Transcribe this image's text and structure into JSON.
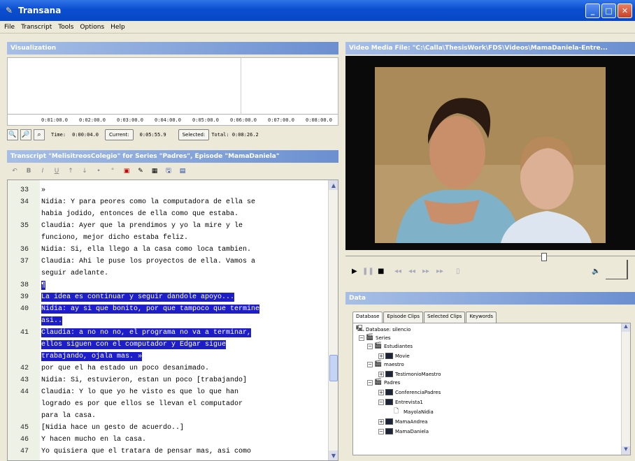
{
  "window": {
    "title": "Transana",
    "buttons": [
      "_",
      "□",
      "✕"
    ]
  },
  "menu": [
    "File",
    "Transcript",
    "Tools",
    "Options",
    "Help"
  ],
  "visualization": {
    "title": "Visualization",
    "ticks": [
      "0:01:00.0",
      "0:02:00.0",
      "0:03:00.0",
      "0:04:00.0",
      "0:05:00.0",
      "0:06:00.0",
      "0:07:00.0",
      "0:08:00.0"
    ],
    "time_label": "Time:",
    "time_value": "0:00:04.0",
    "current_label": "Current:",
    "current_value": "0:05:55.9",
    "selected_label": "Selected:",
    "total_value": "Total: 0:08:26.2"
  },
  "transcript": {
    "title": "Transcript \"MelisitreosColegio\" for Series \"Padres\", Episode \"MamaDaniela\"",
    "lines": [
      {
        "n": "33",
        "t": "»",
        "sel": false
      },
      {
        "n": "34",
        "t": "Nidia: Y para peores como la computadora de ella se",
        "sel": false
      },
      {
        "n": "",
        "t": "habia jodido, entonces de ella como que estaba.",
        "sel": false
      },
      {
        "n": "35",
        "t": "Claudia: Ayer que la prendimos y yo la mire y le",
        "sel": false
      },
      {
        "n": "",
        "t": "funciono, mejor dicho estaba feliz.",
        "sel": false
      },
      {
        "n": "36",
        "t": "Nidia: Si, ella llego a la casa como loca tambien.",
        "sel": false
      },
      {
        "n": "37",
        "t": "Claudia: Ahi le puse los proyectos de ella. Vamos a",
        "sel": false
      },
      {
        "n": "",
        "t": "seguir adelante.",
        "sel": false
      },
      {
        "n": "38",
        "t": "¶",
        "sel": true
      },
      {
        "n": "39",
        "t": "La idea es continuar y seguir dandole apoyo...",
        "sel": true
      },
      {
        "n": "40",
        "t": "Nidia: ay si que bonito, por que tampoco que termine",
        "sel": true
      },
      {
        "n": "",
        "t": "asi..",
        "sel": true
      },
      {
        "n": "41",
        "t": "Claudia: a no no no, el programa no va a terminar,",
        "sel": true
      },
      {
        "n": "",
        "t": "ellos siguen con el computador y Edgar sigue",
        "sel": true
      },
      {
        "n": "",
        "t": "trabajando, ojala mas. »",
        "sel": true
      },
      {
        "n": "42",
        "t": "por que el ha estado un poco desanimado.",
        "sel": false
      },
      {
        "n": "43",
        "t": "Nidia: Si, estuvieron, estan un poco [trabajando]",
        "sel": false
      },
      {
        "n": "44",
        "t": "Claudia: Y lo que yo he visto es que lo que han",
        "sel": false
      },
      {
        "n": "",
        "t": "logrado es por que ellos se llevan el computador",
        "sel": false
      },
      {
        "n": "",
        "t": "para la casa.",
        "sel": false
      },
      {
        "n": "45",
        "t": "[Nidia hace un gesto de acuerdo..]",
        "sel": false
      },
      {
        "n": "46",
        "t": "Y hacen mucho en la casa.",
        "sel": false
      },
      {
        "n": "47",
        "t": "Yo quisiera que el tratara de pensar mas, asi como",
        "sel": false
      }
    ]
  },
  "video": {
    "title": "Video Media File: \"C:\\Calla\\ThesisWork\\FDS\\Videos\\MamaDaniela-Entre..."
  },
  "data_panel": {
    "title": "Data",
    "tabs": [
      "Database",
      "Episode Clips",
      "Selected Clips",
      "Keywords"
    ],
    "tree": [
      {
        "label": "Database: silencio",
        "icon": "db"
      },
      {
        "label": "Series",
        "icon": "series"
      },
      {
        "label": "Estudiantes",
        "icon": "series"
      },
      {
        "label": "Movie",
        "icon": "ep"
      },
      {
        "label": "maestro",
        "icon": "series"
      },
      {
        "label": "TestimonioMaestro",
        "icon": "ep"
      },
      {
        "label": "Padres",
        "icon": "series"
      },
      {
        "label": "ConferenciaPadres",
        "icon": "ep"
      },
      {
        "label": "Entrevista1",
        "icon": "ep"
      },
      {
        "label": "MayolaNidia",
        "icon": "tr"
      },
      {
        "label": "MamaAndrea",
        "icon": "ep"
      },
      {
        "label": "MamaDaniela",
        "icon": "ep"
      }
    ]
  }
}
